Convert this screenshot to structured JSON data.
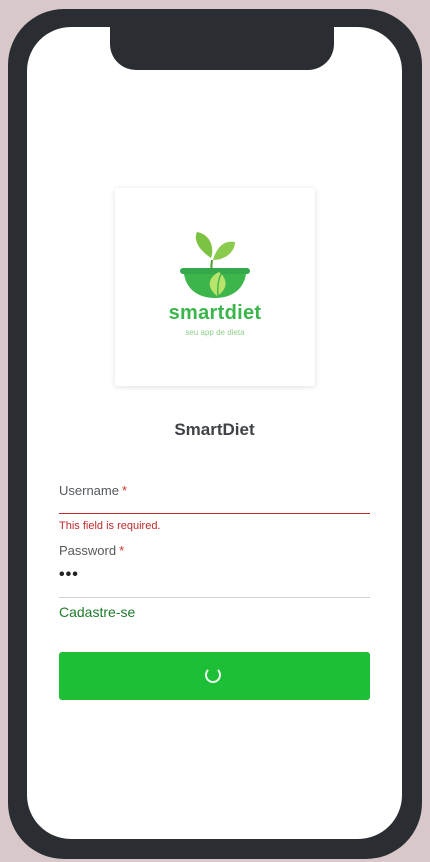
{
  "brand": {
    "wordmark": "smartdiet",
    "tagline": "seu app de dieta",
    "accent_color": "#3cb54a"
  },
  "app_title": "SmartDiet",
  "form": {
    "username": {
      "label": "Username",
      "required_marker": "*",
      "value": "",
      "error": "This field is required.",
      "state": "error"
    },
    "password": {
      "label": "Password",
      "required_marker": "*",
      "masked_value": "•••"
    },
    "signup_link": "Cadastre-se",
    "submit": {
      "state": "loading",
      "icon": "spinner-icon",
      "color": "#1cbf35"
    }
  }
}
